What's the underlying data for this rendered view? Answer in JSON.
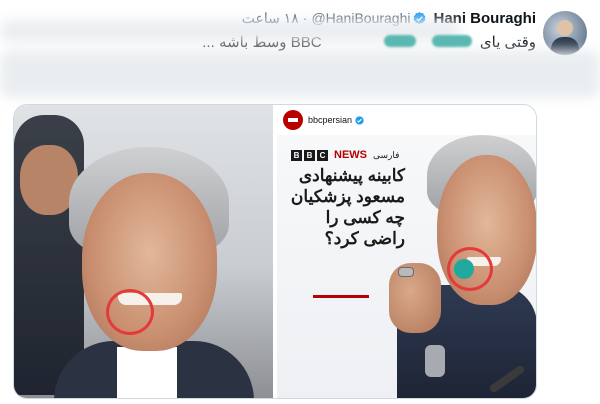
{
  "tweet": {
    "display_name": "Hani Bouraghi",
    "handle": "@HaniBouraghi",
    "separator": "·",
    "time": "۱۸ ساعت",
    "text_visible": "وقتی یای",
    "text_middle": "BBC وسط باشه",
    "text_ellipsis": "...",
    "verified_icon": "verified-badge-icon"
  },
  "embed": {
    "account_name": "bbcpersian",
    "brand_label": "BBC",
    "news_label": "NEWS",
    "language_label": "فارسی",
    "headline": "کابینه پیشنهادی مسعود پزشکیان چه کسی را راضی کرد؟"
  },
  "colors": {
    "accent_blue": "#1d9bf0",
    "bbc_red": "#b80000",
    "highlight_circle": "#e33b3b",
    "teal_marker": "#21a9a0"
  }
}
